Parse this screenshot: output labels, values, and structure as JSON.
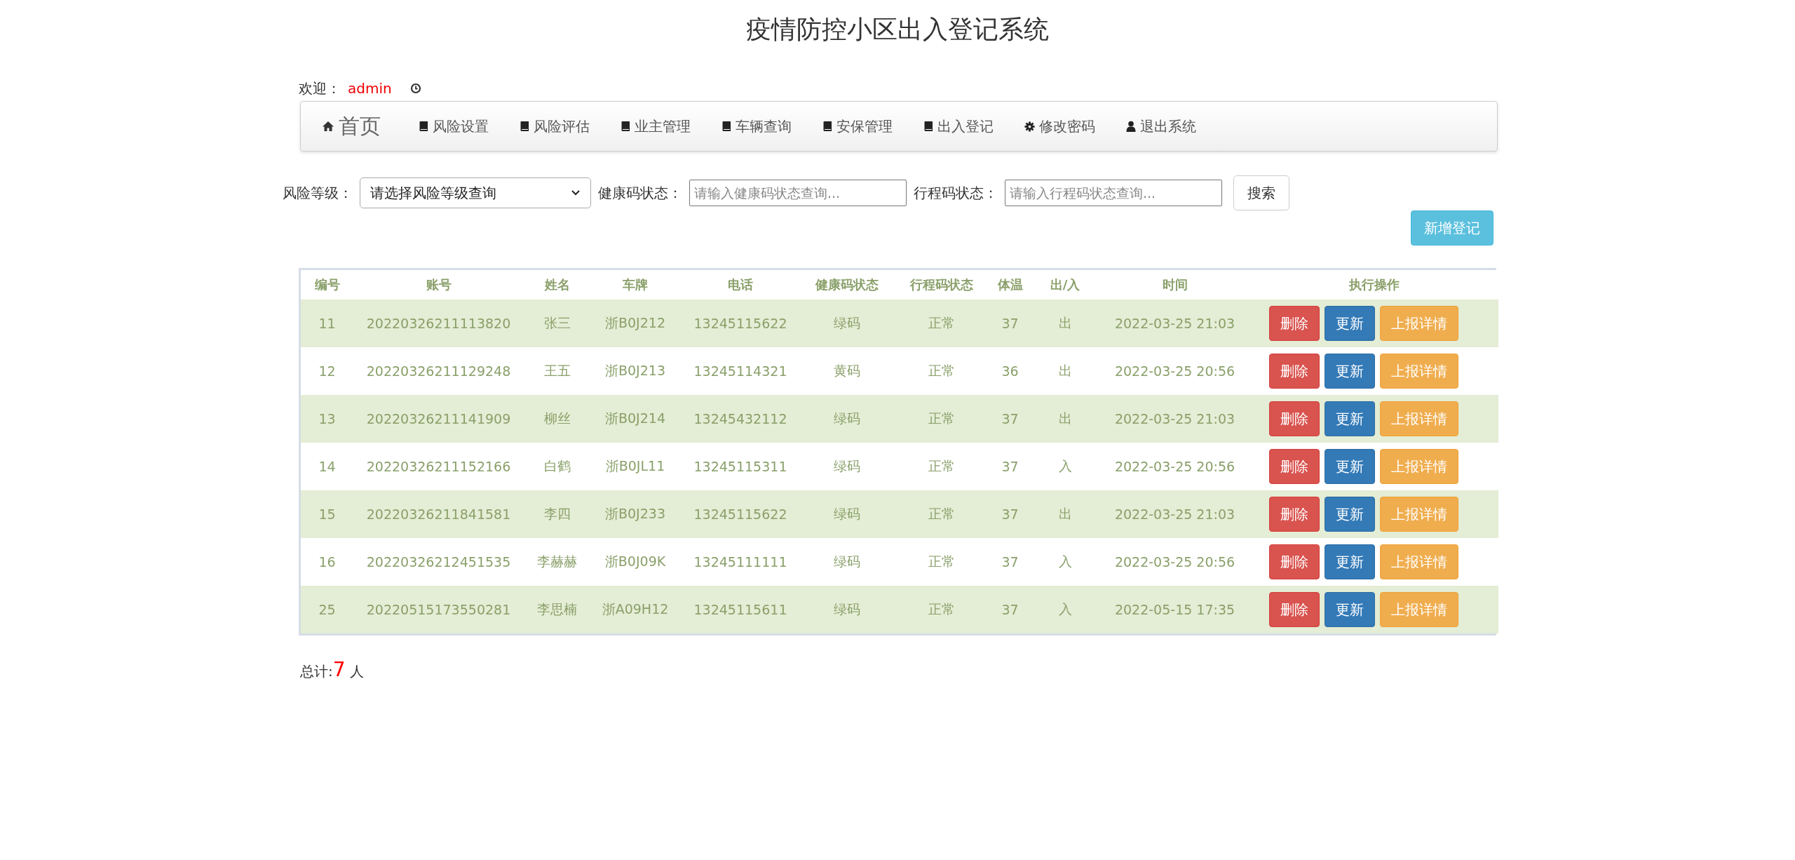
{
  "page_title": "疫情防控小区出入登记系统",
  "welcome": {
    "label": "欢迎：",
    "user": "admin"
  },
  "nav": [
    {
      "label": "首页",
      "kind": "home",
      "selected": true
    },
    {
      "label": "风险设置",
      "kind": "section",
      "selected": false
    },
    {
      "label": "风险评估",
      "kind": "section",
      "selected": false
    },
    {
      "label": "业主管理",
      "kind": "section",
      "selected": false
    },
    {
      "label": "车辆查询",
      "kind": "section",
      "selected": false
    },
    {
      "label": "安保管理",
      "kind": "section",
      "selected": false
    },
    {
      "label": "出入登记",
      "kind": "section",
      "selected": false
    },
    {
      "label": "修改密码",
      "kind": "settings",
      "selected": false
    },
    {
      "label": "退出系统",
      "kind": "account",
      "selected": false
    }
  ],
  "filters": {
    "risk_label": "风险等级：",
    "risk_value": "请选择风险等级查询",
    "health_label": "健康码状态：",
    "health_placeholder": "请输入健康码状态查询...",
    "trip_label": "行程码状态：",
    "trip_placeholder": "请输入行程码状态查询...",
    "search_button": "搜索"
  },
  "add_button": "新增登记",
  "table": {
    "columns": [
      "编号",
      "账号",
      "姓名",
      "车牌",
      "电话",
      "健康码状态",
      "行程码状态",
      "体温",
      "出/入",
      "时间",
      "执行操作"
    ],
    "rows": [
      {
        "cells": [
          "11",
          "20220326211113820",
          "张三",
          "浙B0J212",
          "13245115622",
          "绿码",
          "正常",
          "37",
          "出",
          "2022-03-25 21:03"
        ],
        "actions": [
          {
            "label": "删除",
            "kind": "danger"
          },
          {
            "label": "更新",
            "kind": "primary"
          },
          {
            "label": "上报详情",
            "kind": "warning"
          }
        ]
      },
      {
        "cells": [
          "12",
          "20220326211129248",
          "王五",
          "浙B0J213",
          "13245114321",
          "黄码",
          "正常",
          "36",
          "出",
          "2022-03-25 20:56"
        ],
        "actions": [
          {
            "label": "删除",
            "kind": "danger"
          },
          {
            "label": "更新",
            "kind": "primary"
          },
          {
            "label": "上报详情",
            "kind": "warning"
          }
        ]
      },
      {
        "cells": [
          "13",
          "20220326211141909",
          "柳丝",
          "浙B0J214",
          "13245432112",
          "绿码",
          "正常",
          "37",
          "出",
          "2022-03-25 21:03"
        ],
        "actions": [
          {
            "label": "删除",
            "kind": "danger"
          },
          {
            "label": "更新",
            "kind": "primary"
          },
          {
            "label": "上报详情",
            "kind": "warning"
          }
        ]
      },
      {
        "cells": [
          "14",
          "20220326211152166",
          "白鹤",
          "浙B0JL11",
          "13245115311",
          "绿码",
          "正常",
          "37",
          "入",
          "2022-03-25 20:56"
        ],
        "actions": [
          {
            "label": "删除",
            "kind": "danger"
          },
          {
            "label": "更新",
            "kind": "primary"
          },
          {
            "label": "上报详情",
            "kind": "warning"
          }
        ]
      },
      {
        "cells": [
          "15",
          "20220326211841581",
          "李四",
          "浙B0J233",
          "13245115622",
          "绿码",
          "正常",
          "37",
          "出",
          "2022-03-25 21:03"
        ],
        "actions": [
          {
            "label": "删除",
            "kind": "danger"
          },
          {
            "label": "更新",
            "kind": "primary"
          },
          {
            "label": "上报详情",
            "kind": "warning"
          }
        ]
      },
      {
        "cells": [
          "16",
          "20220326212451535",
          "李赫赫",
          "浙B0J09K",
          "13245111111",
          "绿码",
          "正常",
          "37",
          "入",
          "2022-03-25 20:56"
        ],
        "actions": [
          {
            "label": "删除",
            "kind": "danger"
          },
          {
            "label": "更新",
            "kind": "primary"
          },
          {
            "label": "上报详情",
            "kind": "warning"
          }
        ]
      },
      {
        "cells": [
          "25",
          "20220515173550281",
          "李思楠",
          "浙A09H12",
          "13245115611",
          "绿码",
          "正常",
          "37",
          "入",
          "2022-05-15 17:35"
        ],
        "actions": [
          {
            "label": "删除",
            "kind": "danger"
          },
          {
            "label": "更新",
            "kind": "primary"
          },
          {
            "label": "上报详情",
            "kind": "warning"
          }
        ]
      }
    ]
  },
  "total": {
    "label": "总计:",
    "count": "7",
    "unit": "人"
  }
}
